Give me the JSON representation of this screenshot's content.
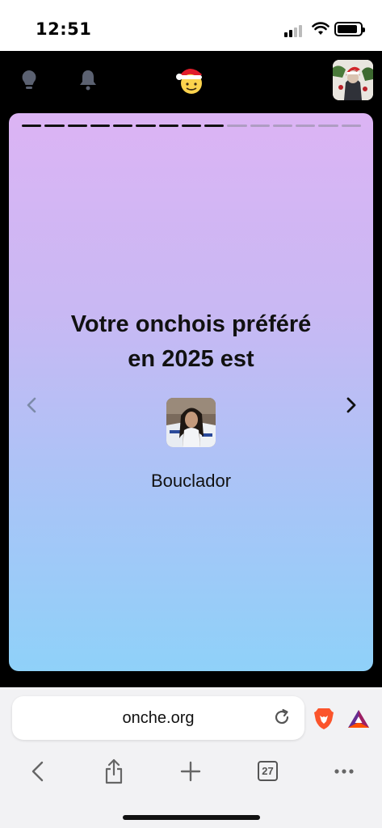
{
  "status_bar": {
    "time": "12:51"
  },
  "story": {
    "progress_total": 15,
    "progress_done": 9,
    "title_line1": "Votre onchois préféré",
    "title_line2": "en 2025 est",
    "user_name": "Bouclador"
  },
  "browser": {
    "url": "onche.org",
    "tabs_count": "27"
  },
  "icons": [
    "lightbulb-icon",
    "bell-icon",
    "santa-emoji-icon",
    "chevron-left-icon",
    "chevron-right-icon",
    "reload-icon",
    "brave-lion-icon",
    "bat-rewards-icon",
    "back-icon",
    "share-icon",
    "plus-icon",
    "tabs-icon",
    "more-icon"
  ],
  "colors": {
    "progress_done": "#111111",
    "progress_todo": "#8a8a9a",
    "card_top": "#dcb4f4",
    "card_bottom": "#8fd1f9"
  }
}
